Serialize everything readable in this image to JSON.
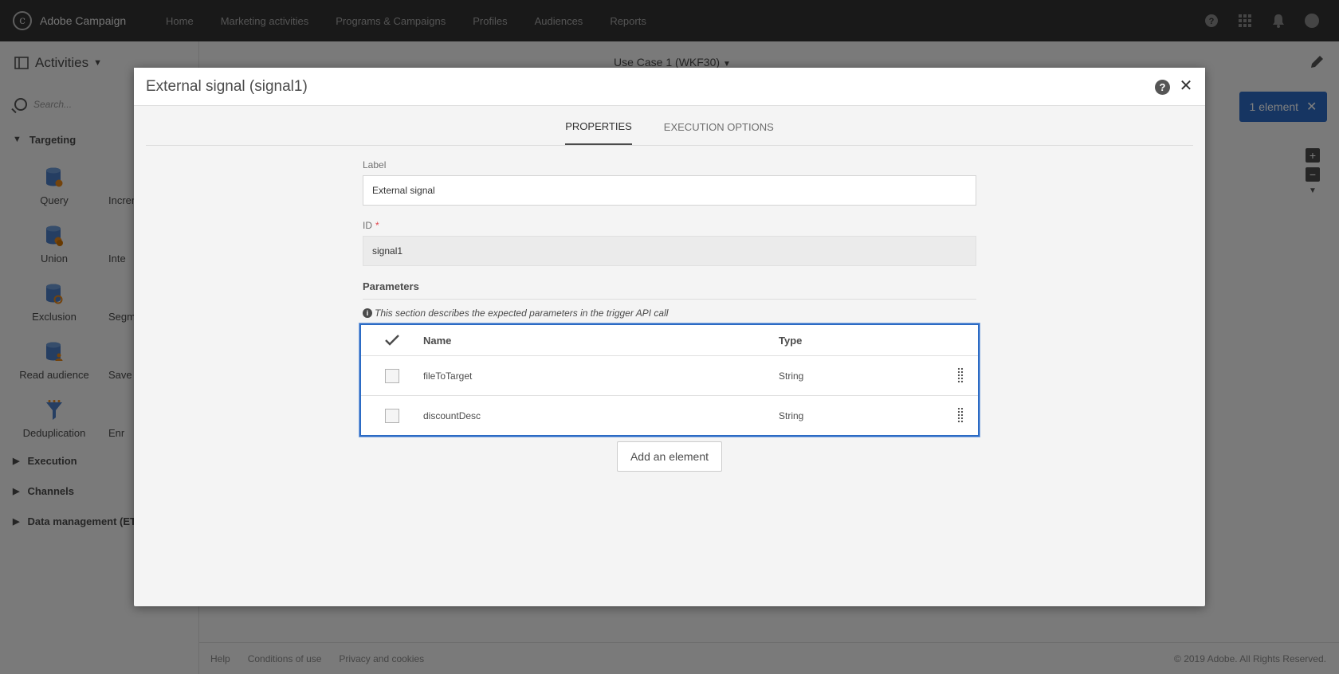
{
  "app": {
    "name": "Adobe Campaign"
  },
  "nav": [
    "Home",
    "Marketing activities",
    "Programs & Campaigns",
    "Profiles",
    "Audiences",
    "Reports"
  ],
  "top_icons": [
    "help-icon",
    "apps-grid-icon",
    "bell-icon",
    "avatar"
  ],
  "left_panel": {
    "title": "Activities",
    "search_placeholder": "Search...",
    "targeting": "Targeting",
    "activities": [
      {
        "left": "Query",
        "right": "Increm"
      },
      {
        "left": "Union",
        "right": "Inte"
      },
      {
        "left": "Exclusion",
        "right": "Segm"
      },
      {
        "left": "Read audience",
        "right": "Save"
      },
      {
        "left": "Deduplication",
        "right": "Enr"
      }
    ],
    "sections": [
      "Execution",
      "Channels",
      "Data management (ETL)"
    ]
  },
  "workflow": {
    "title": "Use Case 1 (WKF30)",
    "selection_badge": "1 element"
  },
  "footer": {
    "links": [
      "Help",
      "Conditions of use",
      "Privacy and cookies"
    ],
    "copyright": "© 2019 Adobe. All Rights Reserved."
  },
  "modal": {
    "title": "External signal (signal1)",
    "tabs": [
      "PROPERTIES",
      "EXECUTION OPTIONS"
    ],
    "label_field": {
      "label": "Label",
      "value": "External signal"
    },
    "id_field": {
      "label": "ID",
      "required": "*",
      "value": "signal1"
    },
    "parameters": {
      "heading": "Parameters",
      "info": "This section describes the expected parameters in the trigger API call",
      "columns": {
        "name": "Name",
        "type": "Type"
      },
      "rows": [
        {
          "name": "fileToTarget",
          "type": "String"
        },
        {
          "name": "discountDesc",
          "type": "String"
        }
      ],
      "add_button": "Add an element"
    }
  },
  "colors": {
    "accent": "#2c6bc4",
    "topbar": "#323232"
  }
}
